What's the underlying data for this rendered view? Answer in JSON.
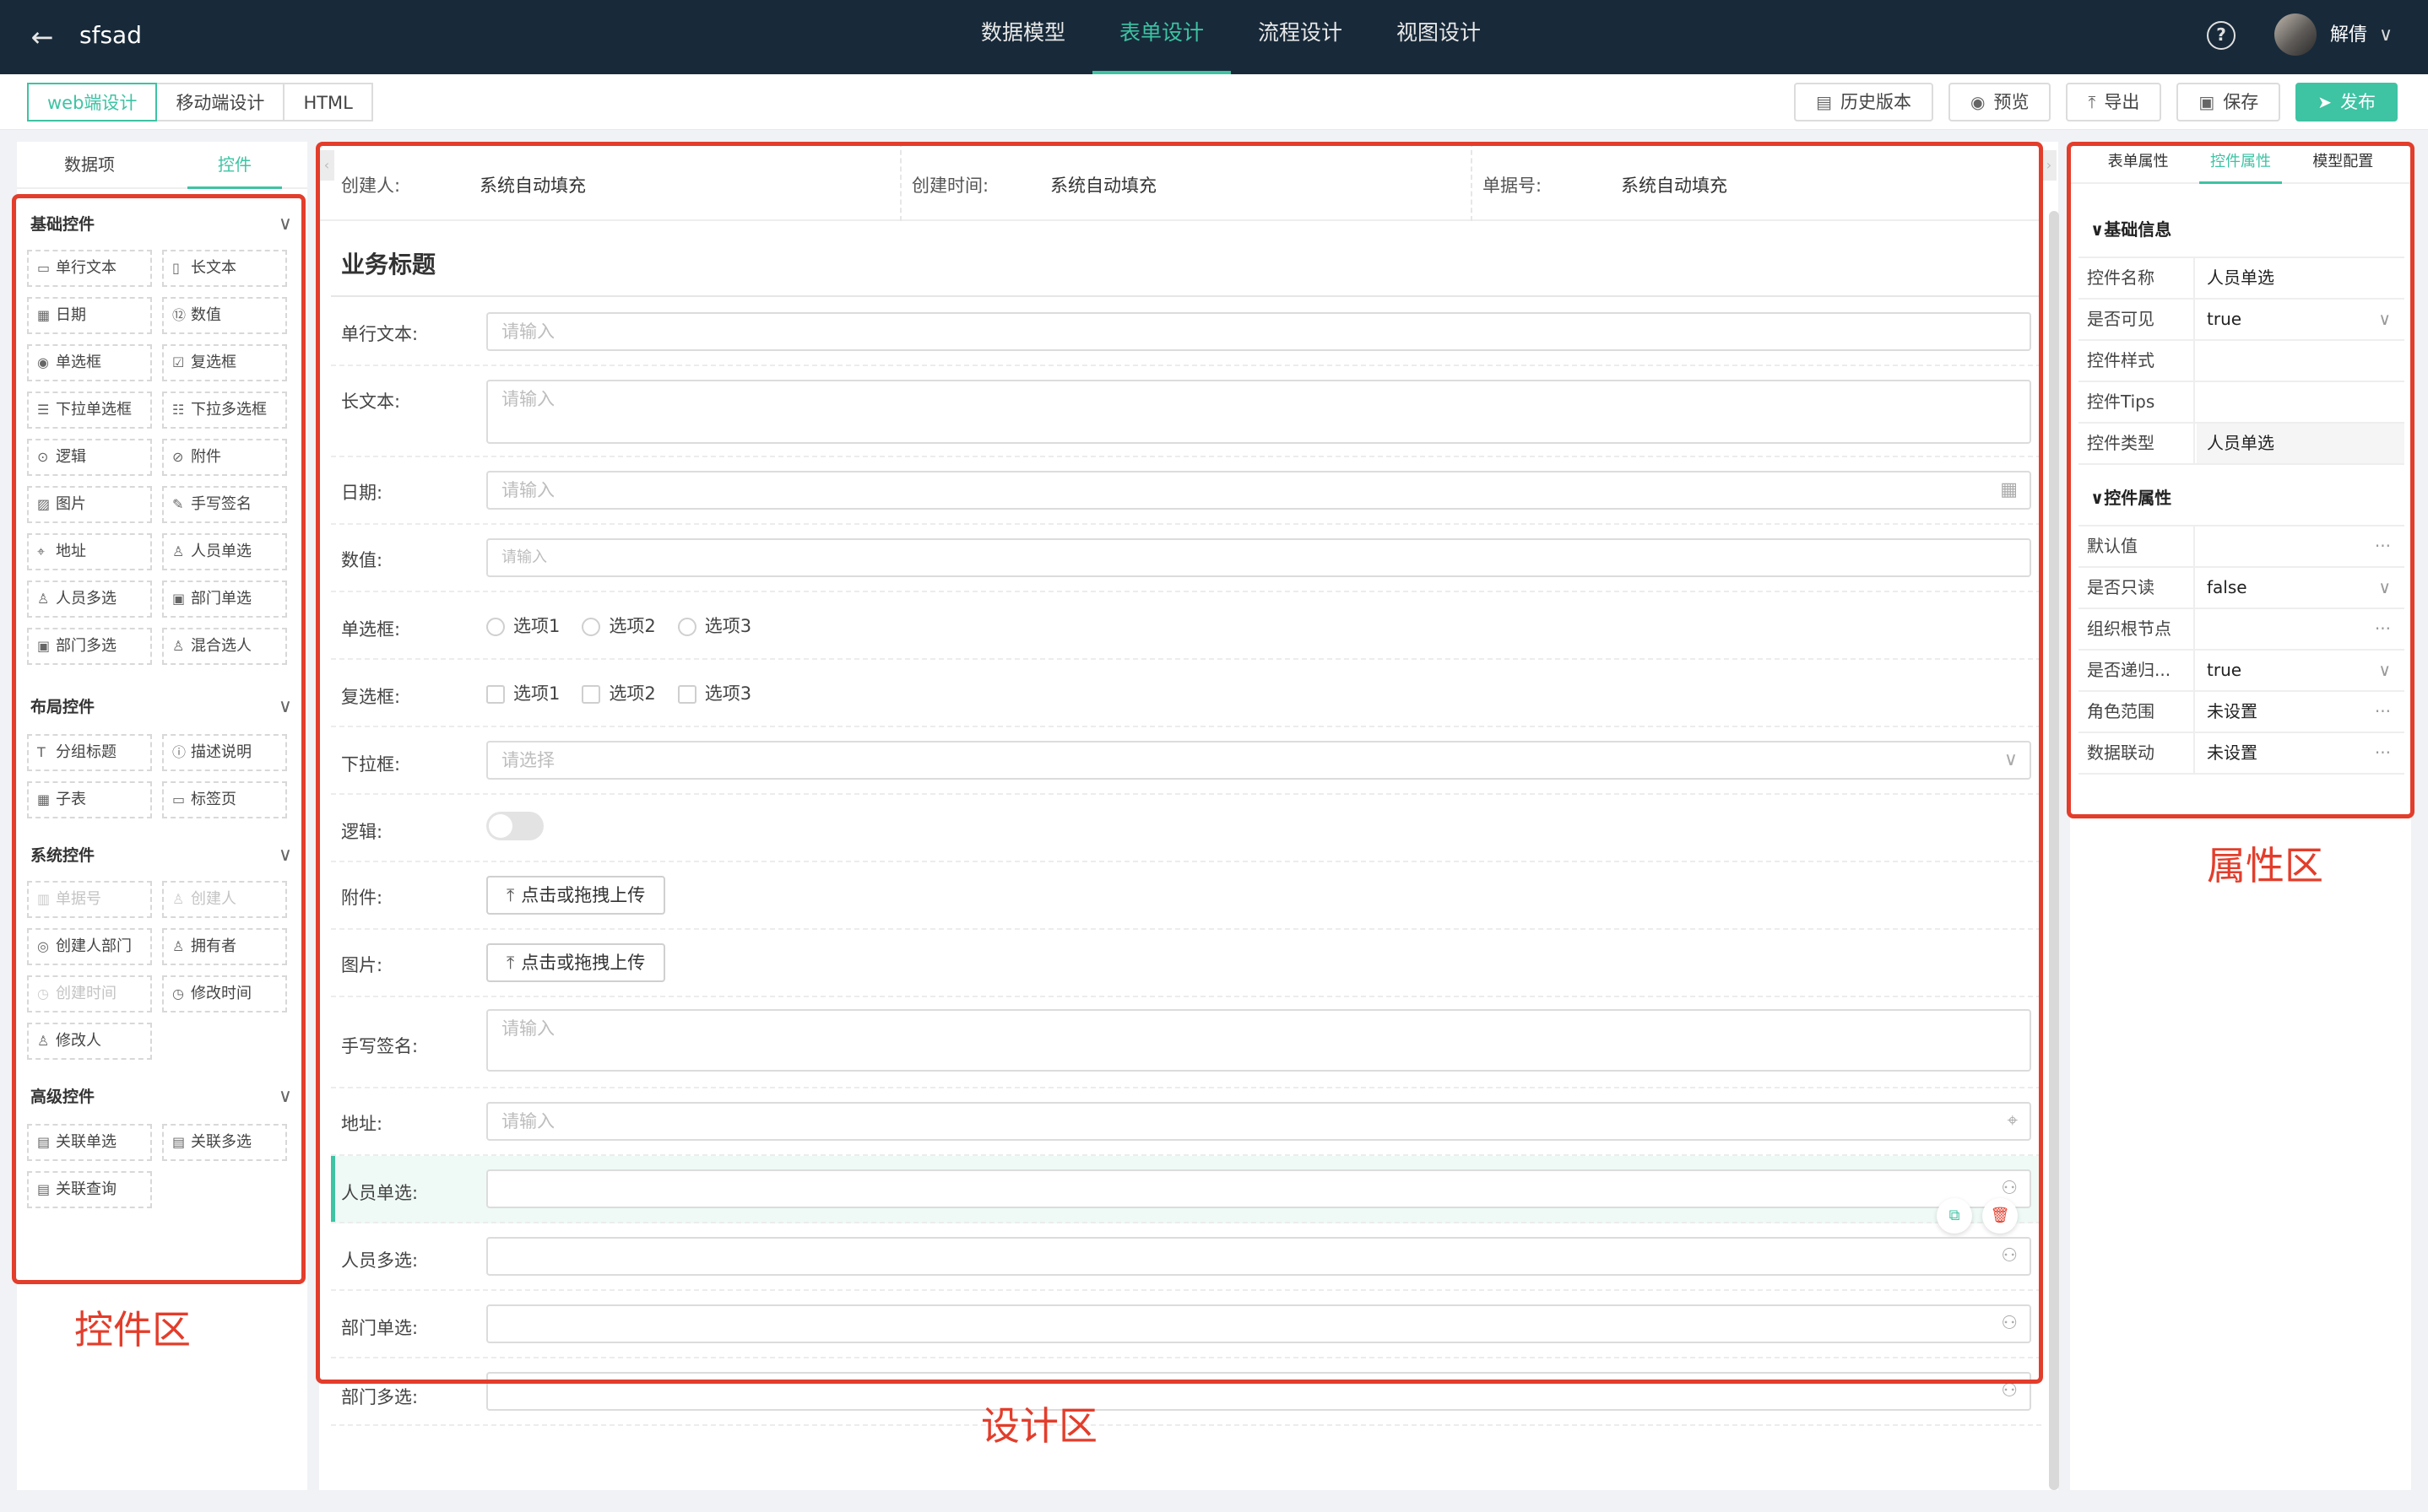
{
  "app": {
    "title": "sfsad",
    "back_icon": "arrow-left-icon"
  },
  "top_nav": [
    {
      "label": "数据模型",
      "active": false
    },
    {
      "label": "表单设计",
      "active": true
    },
    {
      "label": "流程设计",
      "active": false
    },
    {
      "label": "视图设计",
      "active": false
    }
  ],
  "user": {
    "name": "解倩",
    "help_glyph": "?"
  },
  "design_modes": [
    {
      "label": "web端设计",
      "active": true
    },
    {
      "label": "移动端设计",
      "active": false
    },
    {
      "label": "HTML",
      "active": false
    }
  ],
  "toolbar": {
    "history": "历史版本",
    "preview": "预览",
    "export": "导出",
    "save": "保存",
    "publish": "发布"
  },
  "left_panel": {
    "tabs": [
      {
        "label": "数据项",
        "active": false
      },
      {
        "label": "控件",
        "active": true
      }
    ],
    "groups": [
      {
        "title": "基础控件",
        "items": [
          {
            "label": "单行文本",
            "icon": "input-icon"
          },
          {
            "label": "长文本",
            "icon": "textarea-icon"
          },
          {
            "label": "日期",
            "icon": "calendar-icon"
          },
          {
            "label": "数值",
            "icon": "number-icon"
          },
          {
            "label": "单选框",
            "icon": "radio-icon"
          },
          {
            "label": "复选框",
            "icon": "checkbox-icon"
          },
          {
            "label": "下拉单选框",
            "icon": "list-icon"
          },
          {
            "label": "下拉多选框",
            "icon": "list-multi-icon"
          },
          {
            "label": "逻辑",
            "icon": "toggle-icon"
          },
          {
            "label": "附件",
            "icon": "paperclip-icon"
          },
          {
            "label": "图片",
            "icon": "image-icon"
          },
          {
            "label": "手写签名",
            "icon": "pen-icon"
          },
          {
            "label": "地址",
            "icon": "location-icon"
          },
          {
            "label": "人员单选",
            "icon": "user-icon"
          },
          {
            "label": "人员多选",
            "icon": "users-icon"
          },
          {
            "label": "部门单选",
            "icon": "department-icon"
          },
          {
            "label": "部门多选",
            "icon": "department-multi-icon"
          },
          {
            "label": "混合选人",
            "icon": "user-mix-icon"
          }
        ]
      },
      {
        "title": "布局控件",
        "items": [
          {
            "label": "分组标题",
            "icon": "heading-icon"
          },
          {
            "label": "描述说明",
            "icon": "help-circle-icon"
          },
          {
            "label": "子表",
            "icon": "table-icon"
          },
          {
            "label": "标签页",
            "icon": "tabs-icon"
          }
        ]
      },
      {
        "title": "系统控件",
        "items": [
          {
            "label": "单据号",
            "icon": "barcode-icon",
            "disabled": true
          },
          {
            "label": "创建人",
            "icon": "user-icon",
            "disabled": true
          },
          {
            "label": "创建人部门",
            "icon": "org-icon",
            "disabled": false
          },
          {
            "label": "拥有者",
            "icon": "user-icon",
            "disabled": false
          },
          {
            "label": "创建时间",
            "icon": "clock-icon",
            "disabled": true
          },
          {
            "label": "修改时间",
            "icon": "clock-edit-icon",
            "disabled": false
          },
          {
            "label": "修改人",
            "icon": "user-edit-icon",
            "disabled": false
          }
        ]
      },
      {
        "title": "高级控件",
        "items": [
          {
            "label": "关联单选",
            "icon": "link-form-icon"
          },
          {
            "label": "关联多选",
            "icon": "link-form-multi-icon"
          },
          {
            "label": "关联查询",
            "icon": "link-query-icon"
          }
        ]
      }
    ]
  },
  "system_fields": [
    {
      "label": "创建人:",
      "value": "系统自动填充"
    },
    {
      "label": "创建时间:",
      "value": "系统自动填充"
    },
    {
      "label": "单据号:",
      "value": "系统自动填充"
    }
  ],
  "form": {
    "section_title": "业务标题",
    "fields": [
      {
        "label": "单行文本:",
        "type": "input",
        "placeholder": "请输入"
      },
      {
        "label": "长文本:",
        "type": "textarea",
        "placeholder": "请输入"
      },
      {
        "label": "日期:",
        "type": "date",
        "placeholder": "请输入",
        "suffix_icon": "calendar-icon"
      },
      {
        "label": "数值:",
        "type": "number",
        "placeholder": "请输入"
      },
      {
        "label": "单选框:",
        "type": "radio",
        "options": [
          "选项1",
          "选项2",
          "选项3"
        ]
      },
      {
        "label": "复选框:",
        "type": "checkbox",
        "options": [
          "选项1",
          "选项2",
          "选项3"
        ]
      },
      {
        "label": "下拉框:",
        "type": "select",
        "placeholder": "请选择",
        "suffix_icon": "chevron-down-icon"
      },
      {
        "label": "逻辑:",
        "type": "switch"
      },
      {
        "label": "附件:",
        "type": "upload",
        "button": "点击或拖拽上传"
      },
      {
        "label": "图片:",
        "type": "upload",
        "button": "点击或拖拽上传"
      },
      {
        "label": "手写签名:",
        "type": "textarea",
        "placeholder": "请输入"
      },
      {
        "label": "地址:",
        "type": "address",
        "placeholder": "请输入",
        "suffix_icon": "location-icon"
      },
      {
        "label": "人员单选:",
        "type": "user",
        "suffix_icon": "org-tree-icon",
        "selected": true
      },
      {
        "label": "人员多选:",
        "type": "user",
        "suffix_icon": "org-tree-icon"
      },
      {
        "label": "部门单选:",
        "type": "dept",
        "suffix_icon": "org-tree-icon"
      },
      {
        "label": "部门多选:",
        "type": "dept",
        "suffix_icon": "org-tree-icon"
      }
    ],
    "row_actions": {
      "copy_icon": "copy-icon",
      "delete_icon": "trash-icon"
    }
  },
  "right_panel": {
    "tabs": [
      {
        "label": "表单属性",
        "active": false
      },
      {
        "label": "控件属性",
        "active": true
      },
      {
        "label": "模型配置",
        "active": false
      }
    ],
    "basic_info": {
      "title": "基础信息",
      "rows": [
        {
          "key": "控件名称",
          "value": "人员单选",
          "mark": ""
        },
        {
          "key": "是否可见",
          "value": "true",
          "mark": "∨"
        },
        {
          "key": "控件样式",
          "value": "",
          "mark": ""
        },
        {
          "key": "控件Tips",
          "value": "",
          "mark": ""
        },
        {
          "key": "控件类型",
          "value": "人员单选",
          "mark": "",
          "readonly": true
        }
      ]
    },
    "control_props": {
      "title": "控件属性",
      "rows": [
        {
          "key": "默认值",
          "value": "",
          "mark": "···"
        },
        {
          "key": "是否只读",
          "value": "false",
          "mark": "∨"
        },
        {
          "key": "组织根节点",
          "value": "",
          "mark": "···"
        },
        {
          "key": "是否递归...",
          "value": "true",
          "mark": "∨"
        },
        {
          "key": "角色范围",
          "value": "未设置",
          "mark": "···"
        },
        {
          "key": "数据联动",
          "value": "未设置",
          "mark": "···"
        }
      ]
    }
  },
  "annotations": {
    "controls_area": "控件区",
    "design_area": "设计区",
    "property_area": "属性区",
    "color": "#e33d2b"
  },
  "colors": {
    "accent": "#3ec3a3",
    "topbar": "#182a3a"
  }
}
